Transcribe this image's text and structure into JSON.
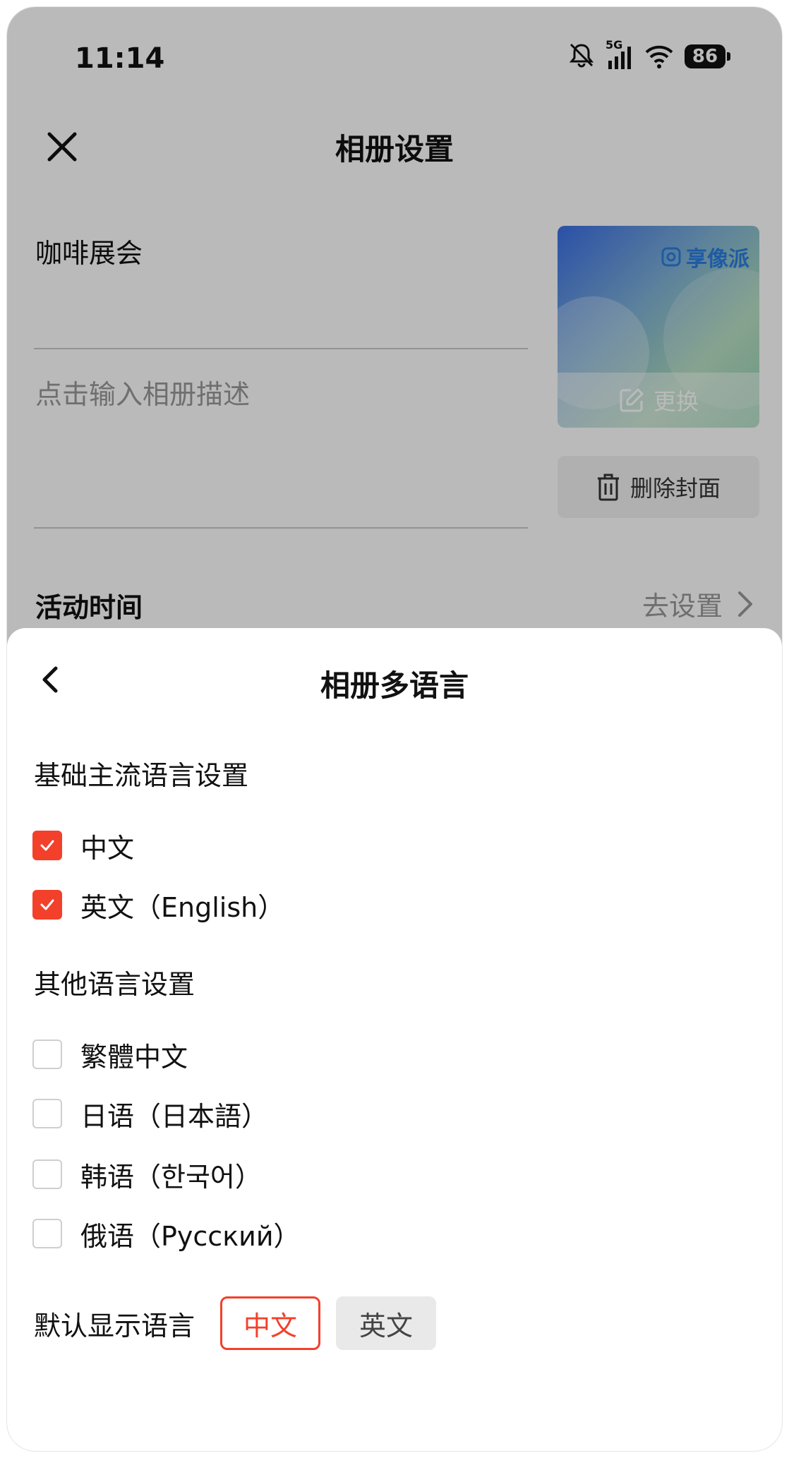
{
  "status_bar": {
    "time": "11:14",
    "network": "5G",
    "battery": "86"
  },
  "header": {
    "title": "相册设置"
  },
  "album": {
    "name": "咖啡展会",
    "description_placeholder": "点击输入相册描述",
    "cover_brand": "享像派",
    "change_cover_label": "更换",
    "delete_cover_label": "删除封面"
  },
  "activity_time": {
    "label": "活动时间",
    "value": "去设置"
  },
  "sheet": {
    "title": "相册多语言",
    "basic_section_title": "基础主流语言设置",
    "basic_languages": [
      {
        "label": "中文",
        "checked": true
      },
      {
        "label": "英文（English）",
        "checked": true
      }
    ],
    "other_section_title": "其他语言设置",
    "other_languages": [
      {
        "label": "繁體中文",
        "checked": false
      },
      {
        "label": "日语（日本語）",
        "checked": false
      },
      {
        "label": "韩语（한국어）",
        "checked": false
      },
      {
        "label": "俄语（Русский）",
        "checked": false
      }
    ],
    "default_language": {
      "label": "默认显示语言",
      "options": [
        "中文",
        "英文"
      ],
      "selected": "中文"
    }
  },
  "colors": {
    "accent": "#f3402b",
    "brand_blue": "#2a7de1"
  }
}
